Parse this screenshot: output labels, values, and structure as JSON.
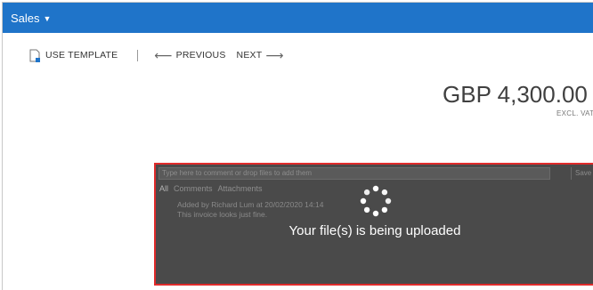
{
  "header": {
    "title": "Sales",
    "caret_icon": "caret-down-icon",
    "bg_color": "#1f74c9"
  },
  "toolbar": {
    "use_template_label": "USE TEMPLATE",
    "use_template_icon": "document-icon",
    "previous_label": "PREVIOUS",
    "previous_icon": "arrow-left-icon",
    "next_label": "NEXT",
    "next_icon": "arrow-right-icon"
  },
  "summary": {
    "amount": "GBP 4,300.00",
    "tax_note": "EXCL. VAT"
  },
  "comments_panel": {
    "input_placeholder": "Type here to comment or drop files to add them",
    "save_label": "Save",
    "tabs": [
      "All",
      "Comments",
      "Attachments"
    ],
    "entry_author_line": "Added by Richard Lum at 20/02/2020 14:14",
    "entry_text": "This invoice looks just fine.",
    "border_color": "#e02b2b"
  },
  "overlay": {
    "spinner_icon": "loading-spinner-icon",
    "message": "Your file(s) is being uploaded"
  }
}
